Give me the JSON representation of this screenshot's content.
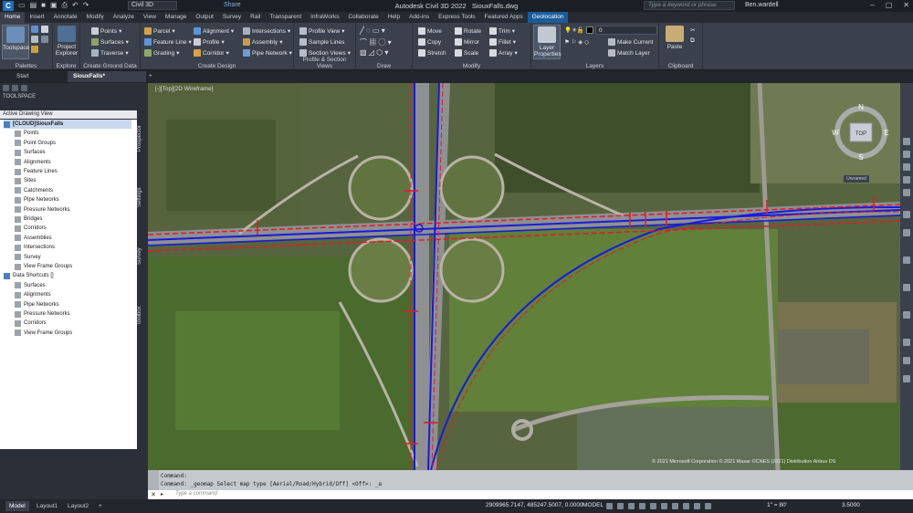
{
  "titlebar": {
    "workspace": "Civil 3D",
    "share": "Share",
    "app_title": "Autodesk Civil 3D 2022",
    "file_name": "SiouxFalls.dwg",
    "search_placeholder": "Type a keyword or phrase",
    "user": "Ben.wardell"
  },
  "tabs": [
    "Home",
    "Insert",
    "Annotate",
    "Modify",
    "Analyze",
    "View",
    "Manage",
    "Output",
    "Survey",
    "Rail",
    "Transparent",
    "InfraWorks",
    "Collaborate",
    "Help",
    "Add-ins",
    "Express Tools",
    "Featured Apps",
    "Geolocation"
  ],
  "ribbon": {
    "toolspace": "Toolspace",
    "project_explorer": "Project Explorer",
    "points": "Points",
    "surfaces": "Surfaces",
    "traverse": "Traverse",
    "parcel": "Parcel",
    "feature_line": "Feature Line",
    "grading": "Grading",
    "alignment": "Alignment",
    "profile": "Profile",
    "corridor": "Corridor",
    "intersections": "Intersections",
    "assembly": "Assembly",
    "pipe_network": "Pipe Network",
    "profile_view": "Profile View",
    "sample_lines": "Sample Lines",
    "section_views": "Section Views",
    "move": "Move",
    "copy": "Copy",
    "stretch": "Stretch",
    "rotate": "Rotate",
    "mirror": "Mirror",
    "scale": "Scale",
    "trim": "Trim",
    "fillet": "Fillet",
    "array": "Array",
    "layer_properties": "Layer Properties",
    "layer_value": "0",
    "make_current": "Make Current",
    "match_layer": "Match Layer",
    "paste": "Paste",
    "panels": {
      "palettes": "Palettes",
      "explore": "Explore",
      "create_ground_data": "Create Ground Data",
      "create_design": "Create Design",
      "profile_section_views": "Profile & Section Views",
      "draw": "Draw",
      "modify": "Modify",
      "layers": "Layers",
      "clipboard": "Clipboard"
    }
  },
  "doc_tabs": {
    "start": "Start",
    "file": "SiouxFalls*"
  },
  "toolspace": {
    "title": "TOOLSPACE",
    "view": "Active Drawing View",
    "side_tabs": [
      "Prospector",
      "Settings",
      "Survey",
      "Toolbox"
    ],
    "tree": [
      {
        "label": "[CLOUD]SiouxFalls",
        "level": 0,
        "root": true
      },
      {
        "label": "Points",
        "level": 1
      },
      {
        "label": "Point Groups",
        "level": 1
      },
      {
        "label": "Surfaces",
        "level": 1
      },
      {
        "label": "Alignments",
        "level": 1
      },
      {
        "label": "Feature Lines",
        "level": 1
      },
      {
        "label": "Sites",
        "level": 1
      },
      {
        "label": "Catchments",
        "level": 1
      },
      {
        "label": "Pipe Networks",
        "level": 1
      },
      {
        "label": "Pressure Networks",
        "level": 1
      },
      {
        "label": "Bridges",
        "level": 1
      },
      {
        "label": "Corridors",
        "level": 1
      },
      {
        "label": "Assemblies",
        "level": 1
      },
      {
        "label": "Intersections",
        "level": 1
      },
      {
        "label": "Survey",
        "level": 1
      },
      {
        "label": "View Frame Groups",
        "level": 1
      },
      {
        "label": "Data Shortcuts []",
        "level": 0
      },
      {
        "label": "Surfaces",
        "level": 1
      },
      {
        "label": "Alignments",
        "level": 1
      },
      {
        "label": "Pipe Networks",
        "level": 1
      },
      {
        "label": "Pressure Networks",
        "level": 1
      },
      {
        "label": "Corridors",
        "level": 1
      },
      {
        "label": "View Frame Groups",
        "level": 1
      }
    ]
  },
  "viewport": {
    "label": "[-][Top][2D Wireframe]",
    "viewcube": {
      "top": "TOP",
      "n": "N",
      "s": "S",
      "e": "E",
      "w": "W"
    },
    "unnamed": "Unnamed",
    "copyright": "© 2021 Microsoft Corporation © 2021 Maxar ©CNES (2021) Distribution Airbus DS"
  },
  "command": {
    "line1": "Command:",
    "line2": "Command: _geomap Select map type [Aerial/Road/Hybrid/Off] <Off>: _a",
    "placeholder": "Type a command"
  },
  "status": {
    "layouts": [
      "Model",
      "Layout1",
      "Layout2"
    ],
    "coords": "2909965.7147, 485247.5007, 0.0000",
    "model": "MODEL",
    "scale": "1\" = 80'",
    "zoom": "3.5000"
  },
  "colors": {
    "accent": "#1b5d9c",
    "alignment": "#1a1adb",
    "offset": "#e01a2a"
  }
}
